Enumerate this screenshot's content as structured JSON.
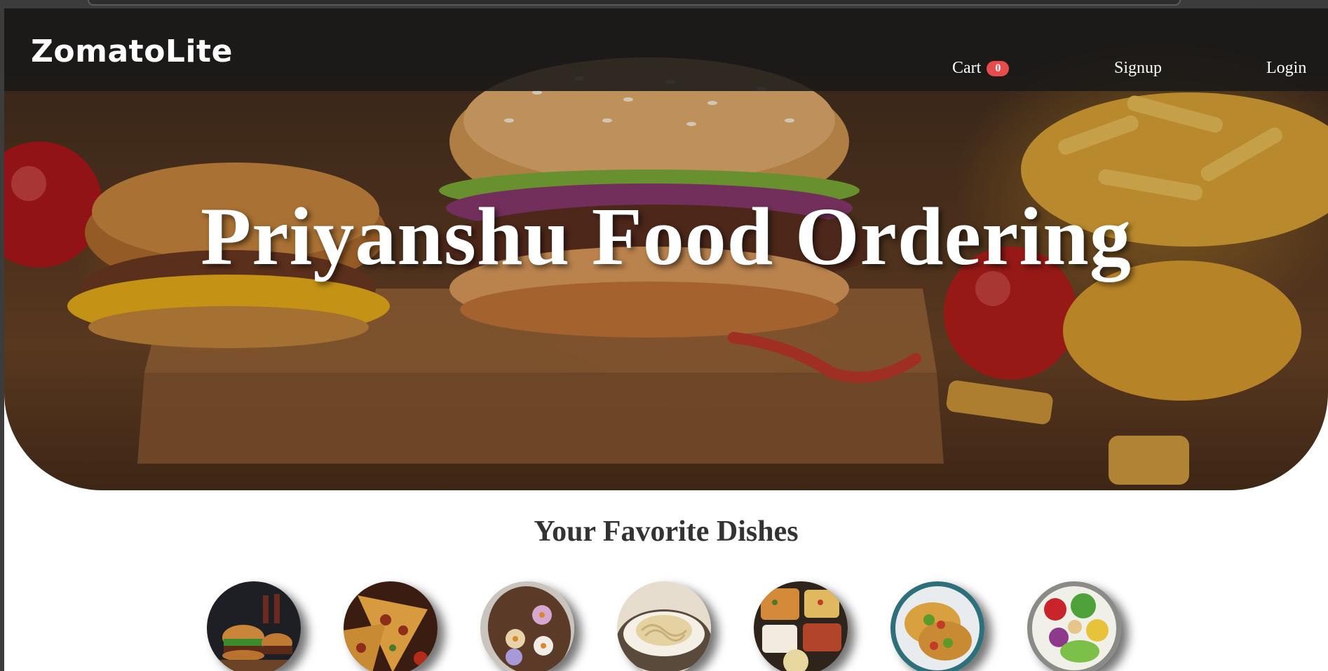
{
  "navbar": {
    "brand": "ZomatoLite",
    "cart_label": "Cart",
    "cart_count": "0",
    "signup_label": "Signup",
    "login_label": "Login"
  },
  "hero": {
    "title": "Priyanshu Food Ordering"
  },
  "favorites": {
    "title": "Your Favorite Dishes",
    "dishes": [
      {
        "name": "burger-dish"
      },
      {
        "name": "pizza-dish"
      },
      {
        "name": "flower-pastry-dish"
      },
      {
        "name": "pasta-dish"
      },
      {
        "name": "platter-dish"
      },
      {
        "name": "tacos-dish"
      },
      {
        "name": "salad-dish"
      }
    ]
  },
  "colors": {
    "navbar_bg": "#181818",
    "badge": "#e74c4c",
    "title_text": "#333333"
  }
}
